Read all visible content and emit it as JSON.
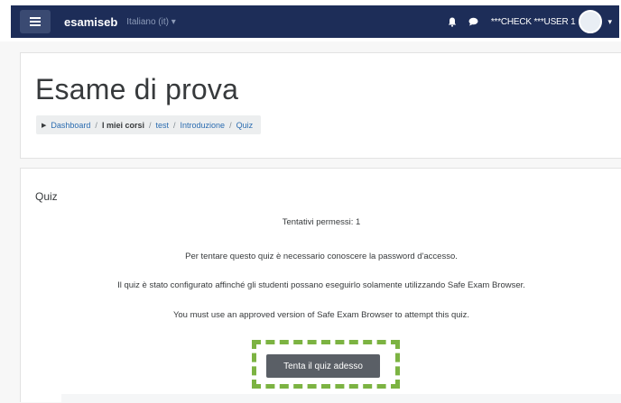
{
  "navbar": {
    "menu_icon": "hamburger-icon",
    "brand": "esamiseb",
    "language": "Italiano (it) ▾",
    "notification_icon": "bell-icon",
    "message_icon": "chat-bubble-icon",
    "username": "***CHECK ***USER 1"
  },
  "header": {
    "title": "Esame di prova",
    "breadcrumb": [
      {
        "label": "Dashboard",
        "link": true
      },
      {
        "label": "I miei corsi",
        "link": false
      },
      {
        "label": "test",
        "link": true
      },
      {
        "label": "Introduzione",
        "link": true
      },
      {
        "label": "Quiz",
        "link": true
      }
    ]
  },
  "quiz": {
    "heading": "Quiz",
    "attempts": "Tentativi permessi: 1",
    "password_notice": "Per tentare questo quiz è necessario conoscere la password d'accesso.",
    "seb_notice": "Il quiz è stato configurato affinché gli studenti possano eseguirlo solamente utilizzando Safe Exam Browser.",
    "seb_version_notice": "You must use an approved version of Safe Exam Browser to attempt this quiz.",
    "start_button": "Tenta il quiz adesso"
  },
  "colors": {
    "navbar_bg": "#1d2d58",
    "link": "#2b6cb0",
    "button_bg": "#5a5f66",
    "highlight": "#7cb342"
  }
}
